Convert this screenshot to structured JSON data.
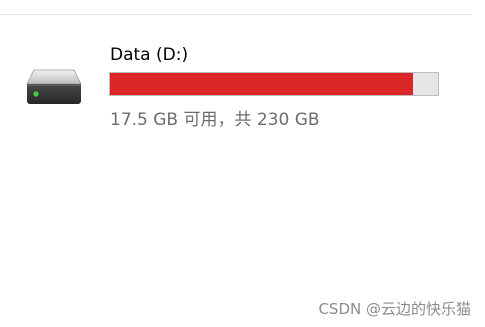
{
  "drive": {
    "name": "Data (D:)",
    "space_text": "17.5 GB 可用，共 230 GB",
    "used_fraction": 0.924,
    "bar_color": "#da2626",
    "track_color": "#e6e6e6",
    "icon": "hard-drive-icon"
  },
  "watermark": {
    "text": "CSDN @云边的快乐猫"
  }
}
